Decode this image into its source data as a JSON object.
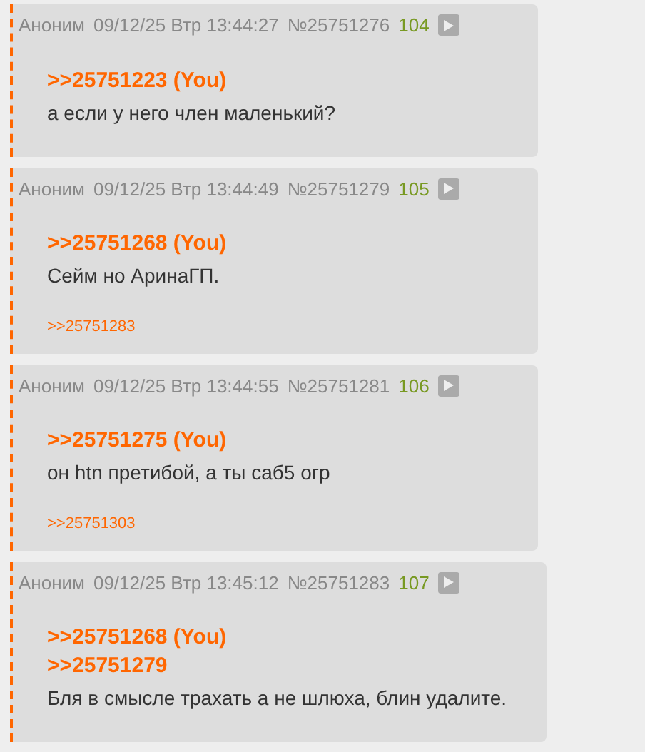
{
  "posts": [
    {
      "name": "Аноним",
      "date": "09/12/25 Втр 13:44:27",
      "number": "№25751276",
      "ordinal": "104",
      "quotes": [
        ">>25751223 (You)"
      ],
      "text": "а если у него член маленький?"
    },
    {
      "name": "Аноним",
      "date": "09/12/25 Втр 13:44:49",
      "number": "№25751279",
      "ordinal": "105",
      "quotes": [
        ">>25751268 (You)"
      ],
      "text": "Сейм но АринаГП.",
      "replies": [
        ">>25751283"
      ]
    },
    {
      "name": "Аноним",
      "date": "09/12/25 Втр 13:44:55",
      "number": "№25751281",
      "ordinal": "106",
      "quotes": [
        ">>25751275 (You)"
      ],
      "text": "он htn претибой, а ты саб5 огр",
      "replies": [
        ">>25751303"
      ]
    },
    {
      "name": "Аноним",
      "date": "09/12/25 Втр 13:45:12",
      "number": "№25751283",
      "ordinal": "107",
      "quotes": [
        ">>25751268 (You)",
        ">>25751279"
      ],
      "text": "Бля в смысле трахать а не шлюха, блин удалите."
    }
  ]
}
